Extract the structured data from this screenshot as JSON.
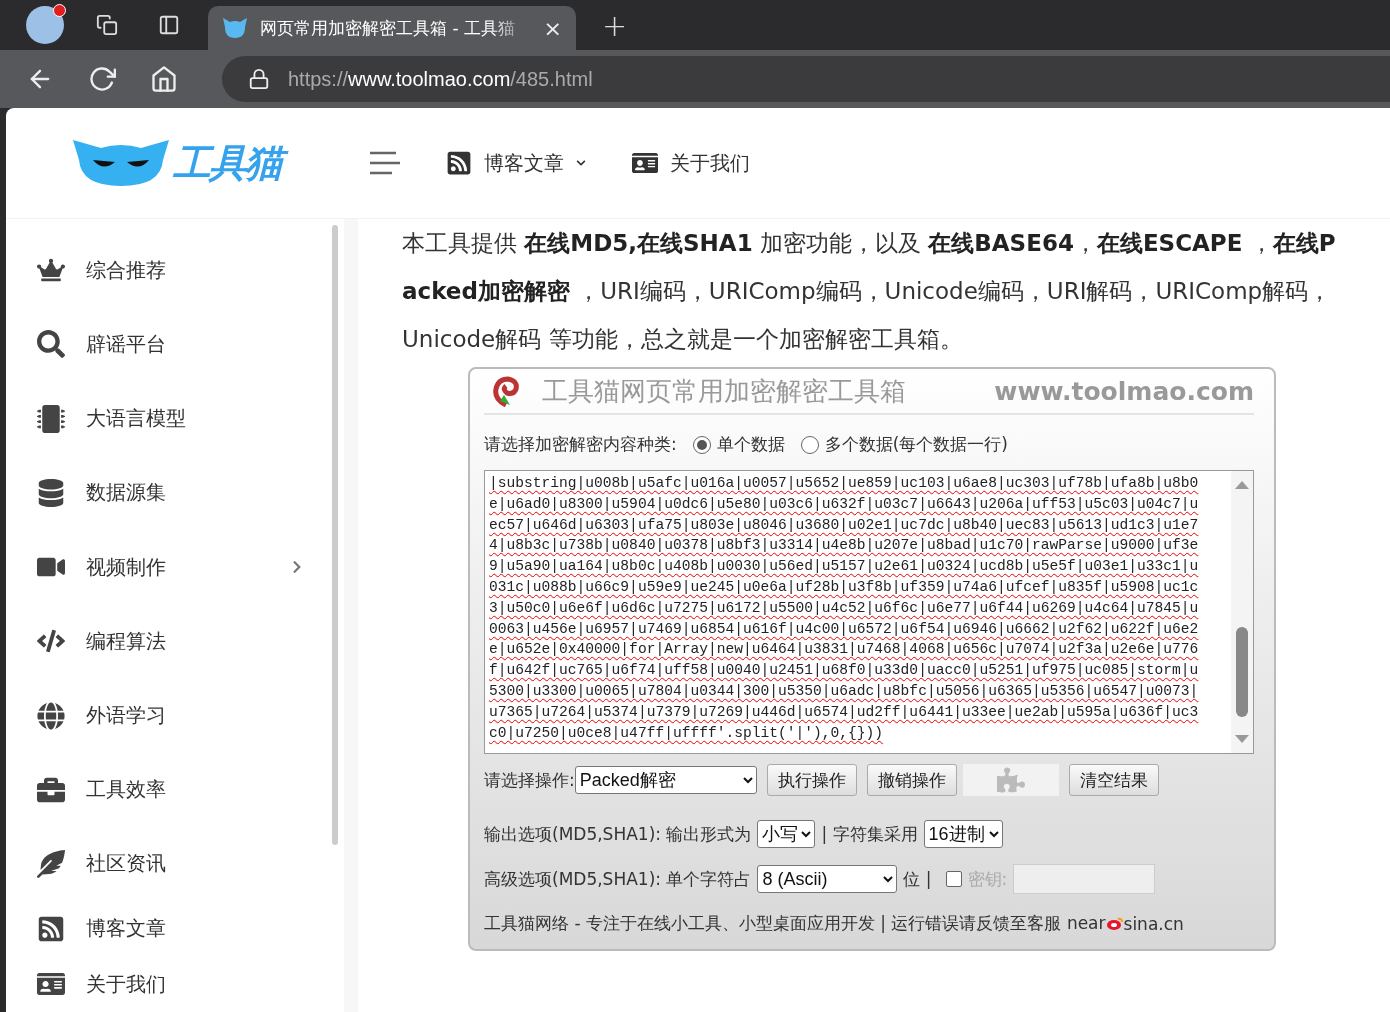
{
  "browser": {
    "tab": {
      "title": "网页常用加密解密工具箱 - 工具猫",
      "close": "×"
    },
    "new_tab": "+",
    "url": {
      "scheme": "https://",
      "host": "www.toolmao.com",
      "path": "/485.html"
    }
  },
  "header": {
    "logo_text": "工具猫",
    "nav": [
      {
        "label": "博客文章",
        "kind": "dropdown"
      },
      {
        "label": "关于我们",
        "kind": "link"
      }
    ]
  },
  "sidebar": {
    "items": [
      {
        "label": "综合推荐",
        "expandable": false
      },
      {
        "label": "辟谣平台",
        "expandable": false
      },
      {
        "label": "大语言模型",
        "expandable": false
      },
      {
        "label": "数据源集",
        "expandable": false
      },
      {
        "label": "视频制作",
        "expandable": true
      },
      {
        "label": "编程算法",
        "expandable": false
      },
      {
        "label": "外语学习",
        "expandable": false
      },
      {
        "label": "工具效率",
        "expandable": false
      },
      {
        "label": "社区资讯",
        "expandable": false
      },
      {
        "label": "博客文章",
        "expandable": false
      },
      {
        "label": "关于我们",
        "expandable": false
      }
    ]
  },
  "intro": "本工具提供 **在线MD5,在线SHA1** 加密功能，以及 **在线BASE64**，**在线ESCAPE** ，**在线Packed加密解密** ，URI编码，URIComp编码，Unicode编码，URI解码，URIComp解码，Unicode解码 等功能，总之就是一个加密解密工具箱。",
  "tool": {
    "title": "工具猫网页常用加密解密工具箱",
    "site": "www.toolmao.com",
    "mode_label": "请选择加密解密内容种类:",
    "modes": [
      {
        "label": "单个数据",
        "selected": true
      },
      {
        "label": "多个数据(每个数据一行)",
        "selected": false
      }
    ],
    "output_lines": [
      "|substring|u008b|u5afc|u016a|u0057|u5652|ue859|uc103|u6ae8|uc303|uf78b|ufa8b|u8b0",
      "e|u6ad0|u8300|u5904|u0dc6|u5e80|u03c6|u632f|u03c7|u6643|u206a|uff53|u5c03|u04c7|u",
      "ec57|u646d|u6303|ufa75|u803e|u8046|u3680|u02e1|uc7dc|u8b40|uec83|u5613|ud1c3|u1e7",
      "4|u8b3c|u738b|u0840|u0378|u8bf3|u3314|u4e8b|u207e|u8bad|u1c70|rawParse|u9000|uf3e",
      "9|u5a90|ua164|u8b0c|u408b|u0030|u56ed|u5157|u2e61|u0324|ucd8b|u5e5f|u03e1|u33c1|u",
      "031c|u088b|u66c9|u59e9|ue245|u0e6a|uf28b|u3f8b|uf359|u74a6|ufcef|u835f|u5908|uc1c",
      "3|u50c0|u6e6f|u6d6c|u7275|u6172|u5500|u4c52|u6f6c|u6e77|u6f44|u6269|u4c64|u7845|u",
      "0063|u456e|u6957|u7469|u6854|u616f|u4c00|u6572|u6f54|u6946|u6662|u2f62|u622f|u6e2",
      "e|u652e|0x40000|for|Array|new|u6464|u3831|u7468|4068|u656c|u7074|u2f3a|u2e6e|u776",
      "f|u642f|uc765|u6f74|uff58|u0040|u2451|u68f0|u33d0|uacc0|u5251|uf975|uc085|storm|u",
      "5300|u3300|u0065|u7804|u0344|300|u5350|u6adc|u8bfc|u5056|u6365|u5356|u6547|u0073|",
      "u7365|u7264|u5374|u7379|u7269|u446d|u6574|ud2ff|u6441|u33ee|ue2ab|u595a|u636f|uc3",
      "c0|u7250|u0ce8|u47ff|uffff'.split('|'),0,{}))"
    ],
    "operation_label": "请选择操作:",
    "operation": "Packed解密",
    "buttons": [
      {
        "label": "执行操作",
        "kind": "text"
      },
      {
        "label": "撤销操作",
        "kind": "text"
      },
      {
        "kind": "plugin"
      },
      {
        "label": "清空结果",
        "kind": "text"
      }
    ],
    "output_options": {
      "label": "输出选项(MD5,SHA1): 输出形式为",
      "case": "小写",
      "sep": "| 字符集采用",
      "charset": "16进制"
    },
    "advanced": {
      "label": "高级选项(MD5,SHA1): 单个字符占",
      "width": "8 (Ascii)",
      "unit": "位 |",
      "key_checked": false,
      "key_label": "密钥:",
      "key_disabled": true
    },
    "footer": {
      "text": "工具猫网络 - 专注于在线小工具、小型桌面应用开发 | 运行错误请反馈至客服 near",
      "tail": "sina.cn"
    }
  }
}
